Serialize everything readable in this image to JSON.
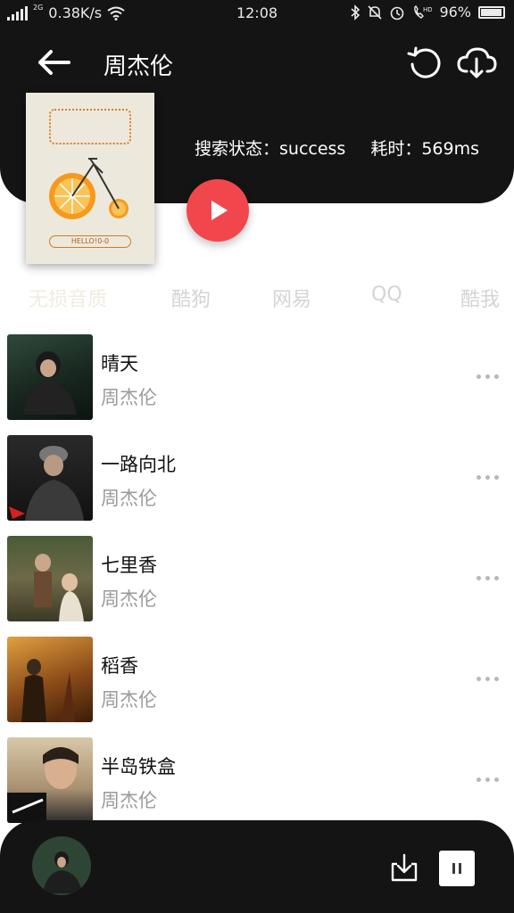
{
  "status_bar": {
    "network_type": "2G",
    "speed": "0.38K/s",
    "time": "12:08",
    "hd_label": "HD",
    "battery": "96%"
  },
  "header": {
    "title": "周杰伦",
    "search_status": "搜索状态：success",
    "elapsed": "耗时：569ms"
  },
  "cover": {
    "caption": "HELLO!0-0"
  },
  "tabs": [
    {
      "label": "无损音质",
      "active": true
    },
    {
      "label": "酷狗",
      "active": false
    },
    {
      "label": "网易",
      "active": false
    },
    {
      "label": "QQ",
      "active": false
    },
    {
      "label": "酷我",
      "active": false
    }
  ],
  "songs": [
    {
      "title": "晴天",
      "artist": "周杰伦"
    },
    {
      "title": "一路向北",
      "artist": "周杰伦"
    },
    {
      "title": "七里香",
      "artist": "周杰伦"
    },
    {
      "title": "稻香",
      "artist": "周杰伦"
    },
    {
      "title": "半岛铁盒",
      "artist": "周杰伦"
    }
  ],
  "colors": {
    "header_bg": "#141414",
    "play_button": "#f2464d",
    "tab_inactive": "#d4d4d4"
  },
  "icons": [
    "back-arrow-icon",
    "refresh-icon",
    "cloud-download-icon",
    "play-icon",
    "more-icon",
    "download-icon",
    "pause-icon"
  ]
}
